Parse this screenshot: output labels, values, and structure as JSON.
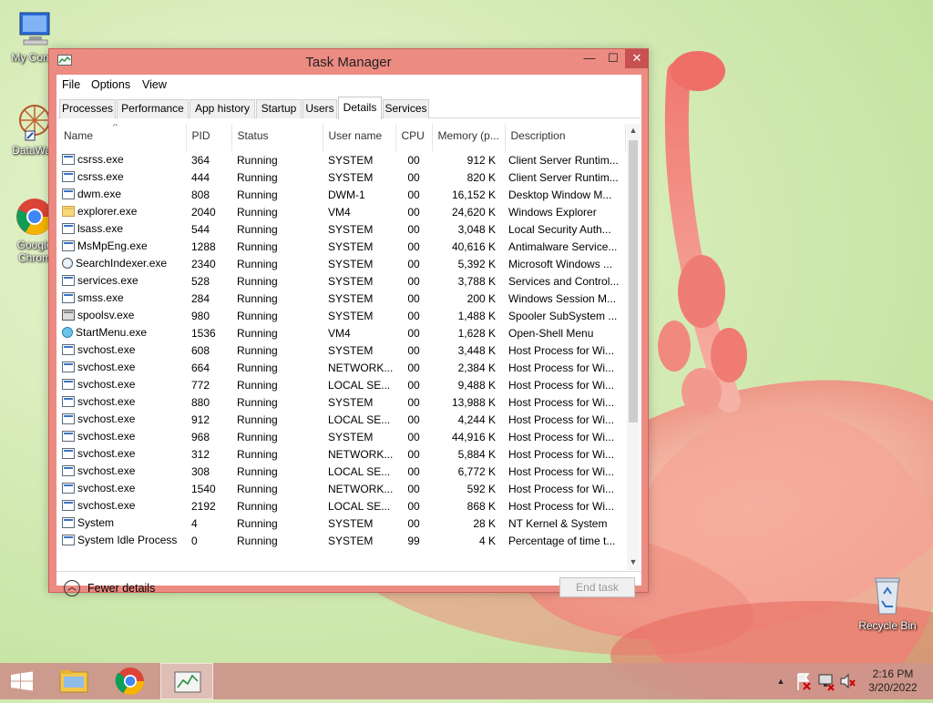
{
  "desktop": {
    "icons": [
      {
        "label": "My Comp",
        "icon": "computer-icon"
      },
      {
        "label": "DataWag",
        "icon": "datawag-icon"
      },
      {
        "label": "Google\nChrom",
        "icon": "chrome-icon"
      },
      {
        "label": "Recycle Bin",
        "icon": "recycle-bin-icon"
      }
    ]
  },
  "window": {
    "title": "Task Manager",
    "controls": {
      "minimize": "—",
      "maximize": "☐",
      "close": "✕"
    },
    "menu": [
      "File",
      "Options",
      "View"
    ],
    "tabs": [
      {
        "label": "Processes",
        "active": false
      },
      {
        "label": "Performance",
        "active": false
      },
      {
        "label": "App history",
        "active": false
      },
      {
        "label": "Startup",
        "active": false
      },
      {
        "label": "Users",
        "active": false
      },
      {
        "label": "Details",
        "active": true
      },
      {
        "label": "Services",
        "active": false
      }
    ],
    "columns": [
      "Name",
      "PID",
      "Status",
      "User name",
      "CPU",
      "Memory (p...",
      "Description"
    ],
    "sort_indicator": "^",
    "rows": [
      [
        "csrss.exe",
        "364",
        "Running",
        "SYSTEM",
        "00",
        "912 K",
        "Client Server Runtim...",
        "app"
      ],
      [
        "csrss.exe",
        "444",
        "Running",
        "SYSTEM",
        "00",
        "820 K",
        "Client Server Runtim...",
        "app"
      ],
      [
        "dwm.exe",
        "808",
        "Running",
        "DWM-1",
        "00",
        "16,152 K",
        "Desktop Window M...",
        "app"
      ],
      [
        "explorer.exe",
        "2040",
        "Running",
        "VM4",
        "00",
        "24,620 K",
        "Windows Explorer",
        "folder"
      ],
      [
        "lsass.exe",
        "544",
        "Running",
        "SYSTEM",
        "00",
        "3,048 K",
        "Local Security Auth...",
        "app"
      ],
      [
        "MsMpEng.exe",
        "1288",
        "Running",
        "SYSTEM",
        "00",
        "40,616 K",
        "Antimalware Service...",
        "app"
      ],
      [
        "SearchIndexer.exe",
        "2340",
        "Running",
        "SYSTEM",
        "00",
        "5,392 K",
        "Microsoft Windows ...",
        "search"
      ],
      [
        "services.exe",
        "528",
        "Running",
        "SYSTEM",
        "00",
        "3,788 K",
        "Services and Control...",
        "app"
      ],
      [
        "smss.exe",
        "284",
        "Running",
        "SYSTEM",
        "00",
        "200 K",
        "Windows Session M...",
        "app"
      ],
      [
        "spoolsv.exe",
        "980",
        "Running",
        "SYSTEM",
        "00",
        "1,488 K",
        "Spooler SubSystem ...",
        "printer"
      ],
      [
        "StartMenu.exe",
        "1536",
        "Running",
        "VM4",
        "00",
        "1,628 K",
        "Open-Shell Menu",
        "globe"
      ],
      [
        "svchost.exe",
        "608",
        "Running",
        "SYSTEM",
        "00",
        "3,448 K",
        "Host Process for Wi...",
        "app"
      ],
      [
        "svchost.exe",
        "664",
        "Running",
        "NETWORK...",
        "00",
        "2,384 K",
        "Host Process for Wi...",
        "app"
      ],
      [
        "svchost.exe",
        "772",
        "Running",
        "LOCAL SE...",
        "00",
        "9,488 K",
        "Host Process for Wi...",
        "app"
      ],
      [
        "svchost.exe",
        "880",
        "Running",
        "SYSTEM",
        "00",
        "13,988 K",
        "Host Process for Wi...",
        "app"
      ],
      [
        "svchost.exe",
        "912",
        "Running",
        "LOCAL SE...",
        "00",
        "4,244 K",
        "Host Process for Wi...",
        "app"
      ],
      [
        "svchost.exe",
        "968",
        "Running",
        "SYSTEM",
        "00",
        "44,916 K",
        "Host Process for Wi...",
        "app"
      ],
      [
        "svchost.exe",
        "312",
        "Running",
        "NETWORK...",
        "00",
        "5,884 K",
        "Host Process for Wi...",
        "app"
      ],
      [
        "svchost.exe",
        "308",
        "Running",
        "LOCAL SE...",
        "00",
        "6,772 K",
        "Host Process for Wi...",
        "app"
      ],
      [
        "svchost.exe",
        "1540",
        "Running",
        "NETWORK...",
        "00",
        "592 K",
        "Host Process for Wi...",
        "app"
      ],
      [
        "svchost.exe",
        "2192",
        "Running",
        "LOCAL SE...",
        "00",
        "868 K",
        "Host Process for Wi...",
        "app"
      ],
      [
        "System",
        "4",
        "Running",
        "SYSTEM",
        "00",
        "28 K",
        "NT Kernel & System",
        "app"
      ],
      [
        "System Idle Process",
        "0",
        "Running",
        "SYSTEM",
        "99",
        "4 K",
        "Percentage of time t...",
        "app"
      ]
    ],
    "footer": {
      "fewer_details": "Fewer details",
      "end_task": "End task"
    }
  },
  "taskbar": {
    "items": [
      "start-icon",
      "file-explorer-icon",
      "chrome-icon",
      "task-manager-icon"
    ],
    "tray_icons": [
      "show-hidden-icons-chevron-icon",
      "action-center-flag-icon",
      "network-icon",
      "volume-muted-icon"
    ],
    "time": "2:16 PM",
    "date": "3/20/2022"
  },
  "colors": {
    "window_frame": "#ec8b82",
    "close_button": "#c75050",
    "taskbar": "#cd968c"
  }
}
